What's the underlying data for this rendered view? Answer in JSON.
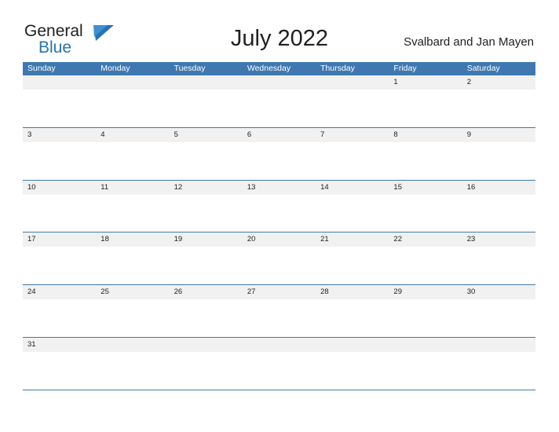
{
  "logo": {
    "word_general": "General",
    "word_blue": "Blue",
    "flag_icon": "blue-flag-icon"
  },
  "header": {
    "title": "July 2022",
    "region": "Svalbard and Jan Mayen"
  },
  "calendar": {
    "day_headers": [
      "Sunday",
      "Monday",
      "Tuesday",
      "Wednesday",
      "Thursday",
      "Friday",
      "Saturday"
    ],
    "header_bg": "#3f78b0",
    "header_text": "#ffffff",
    "cell_shade": "#f1f1f1",
    "weeks": [
      [
        {
          "num": ""
        },
        {
          "num": ""
        },
        {
          "num": ""
        },
        {
          "num": ""
        },
        {
          "num": ""
        },
        {
          "num": "1"
        },
        {
          "num": "2"
        }
      ],
      [
        {
          "num": "3"
        },
        {
          "num": "4"
        },
        {
          "num": "5"
        },
        {
          "num": "6"
        },
        {
          "num": "7"
        },
        {
          "num": "8"
        },
        {
          "num": "9"
        }
      ],
      [
        {
          "num": "10"
        },
        {
          "num": "11"
        },
        {
          "num": "12"
        },
        {
          "num": "13"
        },
        {
          "num": "14"
        },
        {
          "num": "15"
        },
        {
          "num": "16"
        }
      ],
      [
        {
          "num": "17"
        },
        {
          "num": "18"
        },
        {
          "num": "19"
        },
        {
          "num": "20"
        },
        {
          "num": "21"
        },
        {
          "num": "22"
        },
        {
          "num": "23"
        }
      ],
      [
        {
          "num": "24"
        },
        {
          "num": "25"
        },
        {
          "num": "26"
        },
        {
          "num": "27"
        },
        {
          "num": "28"
        },
        {
          "num": "29"
        },
        {
          "num": "30"
        }
      ],
      [
        {
          "num": "31"
        },
        {
          "num": ""
        },
        {
          "num": ""
        },
        {
          "num": ""
        },
        {
          "num": ""
        },
        {
          "num": ""
        },
        {
          "num": ""
        }
      ]
    ]
  }
}
